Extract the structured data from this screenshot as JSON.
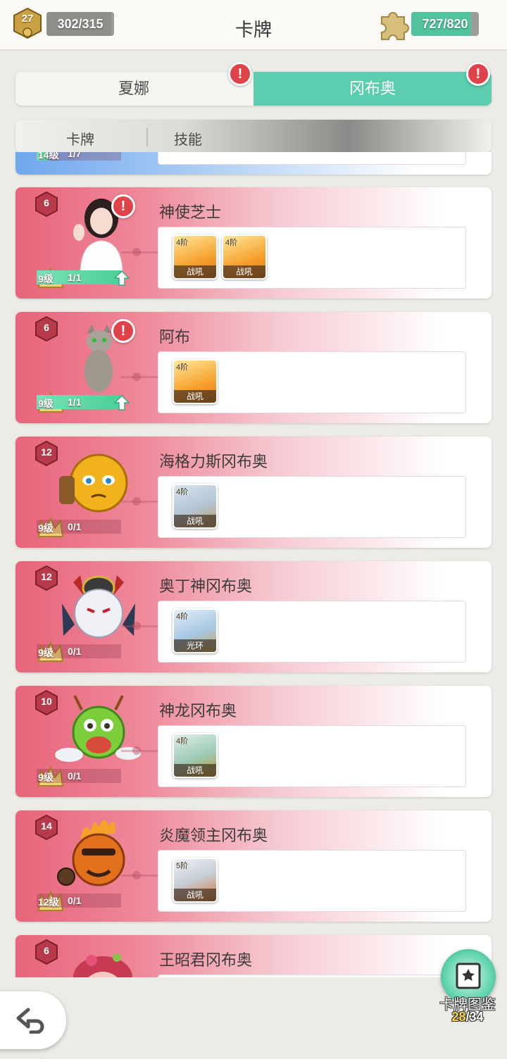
{
  "header": {
    "title": "卡牌",
    "player_level": "27",
    "energy": "302/315",
    "energy_ratio": 0.959,
    "fragments": "727/820",
    "fragments_ratio": 0.887
  },
  "tabs": [
    {
      "label": "夏娜",
      "active": false,
      "alert": "!"
    },
    {
      "label": "冈布奥",
      "active": true,
      "alert": "!"
    }
  ],
  "subtabs": [
    {
      "label": "卡牌"
    },
    {
      "label": "技能"
    }
  ],
  "partial_top_card": {
    "level": "14级",
    "progress": "1/7"
  },
  "cards": [
    {
      "name": "神使芝士",
      "grade": "6",
      "level": "9级",
      "progress": "1/1",
      "upgradable": true,
      "alert": "!",
      "portrait": "girl-portrait-icon",
      "skills": [
        {
          "tier": "4阶",
          "tag": "战吼",
          "icon": "flame-skill-icon"
        },
        {
          "tier": "4阶",
          "tag": "战吼",
          "icon": "flame-skill-icon"
        }
      ]
    },
    {
      "name": "阿布",
      "grade": "6",
      "level": "9级",
      "progress": "1/1",
      "upgradable": true,
      "alert": "!",
      "portrait": "cat-portrait-icon",
      "skills": [
        {
          "tier": "4阶",
          "tag": "战吼",
          "icon": "flame-skill-icon"
        }
      ]
    },
    {
      "name": "海格力斯冈布奥",
      "grade": "12",
      "level": "9级",
      "progress": "0/1",
      "upgradable": false,
      "portrait": "hercules-gumball-icon",
      "skills": [
        {
          "tier": "4阶",
          "tag": "战吼",
          "icon": "lion-skill-icon"
        }
      ]
    },
    {
      "name": "奥丁神冈布奥",
      "grade": "12",
      "level": "9级",
      "progress": "0/1",
      "upgradable": false,
      "portrait": "odin-gumball-icon",
      "skills": [
        {
          "tier": "4阶",
          "tag": "光环",
          "icon": "halo-skill-icon"
        }
      ]
    },
    {
      "name": "神龙冈布奥",
      "grade": "10",
      "level": "9级",
      "progress": "0/1",
      "upgradable": false,
      "portrait": "dragon-gumball-icon",
      "skills": [
        {
          "tier": "4阶",
          "tag": "战吼",
          "icon": "dragon-skill-icon"
        }
      ]
    },
    {
      "name": "炎魔领主冈布奥",
      "grade": "14",
      "level": "12级",
      "progress": "0/1",
      "upgradable": false,
      "portrait": "flame-lord-gumball-icon",
      "skills": [
        {
          "tier": "5阶",
          "tag": "战吼",
          "icon": "fire-beast-skill-icon"
        }
      ]
    },
    {
      "name": "王昭君冈布奥",
      "grade": "6",
      "level": "",
      "progress": "",
      "upgradable": false,
      "portrait": "wang-zhaojun-gumball-icon",
      "skills": []
    }
  ],
  "album": {
    "label": "卡牌图鉴",
    "count_current": "28",
    "count_total": "/34"
  },
  "colors": {
    "accent": "#5ccdae",
    "card_pink": "#e8647a",
    "alert": "#e0424a"
  }
}
